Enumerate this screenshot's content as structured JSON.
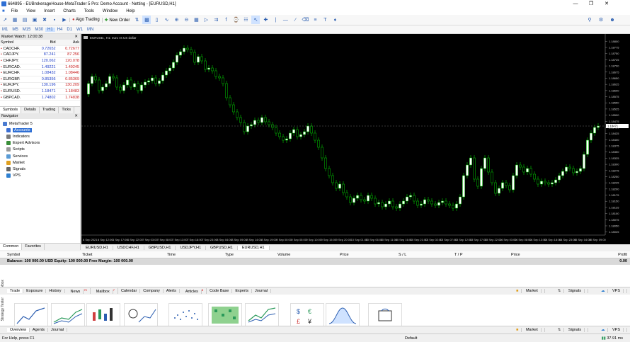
{
  "window": {
    "title": "664895 - EUBrokerageHouse-MetaTrader 5 Pro: Demo Account - Netting - [EURUSD,H1]"
  },
  "menu": [
    "File",
    "View",
    "Insert",
    "Charts",
    "Tools",
    "Window",
    "Help"
  ],
  "toolbar": {
    "algo_trading": "Algo Trading",
    "new_order": "New Order"
  },
  "timeframes": [
    "M1",
    "M5",
    "M15",
    "M30",
    "H1",
    "H4",
    "D1",
    "W1",
    "MN"
  ],
  "market_watch": {
    "title": "Market Watch: 12:00:38",
    "headers": [
      "Symbol",
      "Bid",
      "Ask"
    ],
    "rows": [
      {
        "symbol": "CADCHF.",
        "bid": "0.72652",
        "ask": "0.72677"
      },
      {
        "symbol": "CADJPY.",
        "bid": "87.241",
        "ask": "87.256"
      },
      {
        "symbol": "CHFJPY.",
        "bid": "120.062",
        "ask": "120.078"
      },
      {
        "symbol": "EURCAD.",
        "bid": "1.49221",
        "ask": "1.49245"
      },
      {
        "symbol": "EURCHF.",
        "bid": "1.08432",
        "ask": "1.08446"
      },
      {
        "symbol": "EURGBP.",
        "bid": "0.85356",
        "ask": "0.85369"
      },
      {
        "symbol": "EURJPY.",
        "bid": "130.196",
        "ask": "130.209"
      },
      {
        "symbol": "EURUSD.",
        "bid": "1.18471",
        "ask": "1.18483"
      },
      {
        "symbol": "GBPCAD.",
        "bid": "1.74802",
        "ask": "1.74838"
      }
    ],
    "tabs": [
      "Symbols",
      "Details",
      "Trading",
      "Ticks"
    ]
  },
  "navigator": {
    "title": "Navigator",
    "items": [
      {
        "label": "MetaTrader 5",
        "color": "#4a7bd1"
      },
      {
        "label": "Accounts",
        "color": "#3b6fd4"
      },
      {
        "label": "Indicators",
        "color": "#7a7a7a"
      },
      {
        "label": "Expert Advisors",
        "color": "#3a8f3a"
      },
      {
        "label": "Scripts",
        "color": "#999999"
      },
      {
        "label": "Services",
        "color": "#5a9bd5"
      },
      {
        "label": "Market",
        "color": "#e0a020"
      },
      {
        "label": "Signals",
        "color": "#666666"
      },
      {
        "label": "VPS",
        "color": "#2f80d0"
      }
    ],
    "tabs": [
      "Common",
      "Favorites"
    ]
  },
  "chart": {
    "title": "EURUSD., H1: euro vs US dollar",
    "price_labels": [
      "1.18800",
      "1.18775",
      "1.18750",
      "1.18725",
      "1.18700",
      "1.18675",
      "1.18650",
      "1.18625",
      "1.18600",
      "1.18575",
      "1.18550",
      "1.18525",
      "1.18500",
      "1.18475",
      "1.18450",
      "1.18425",
      "1.18400",
      "1.18375",
      "1.18350",
      "1.18325",
      "1.18300",
      "1.18275",
      "1.18250",
      "1.18225",
      "1.18200",
      "1.18175",
      "1.18150",
      "1.18125",
      "1.18100",
      "1.18075",
      "1.18050",
      "1.18025"
    ],
    "current_price": "1.18471",
    "time_labels": [
      "6 Sep 2021",
      "6 Sep 12:00",
      "6 Sep 17:00",
      "6 Sep 22:00",
      "7 Sep 03:00",
      "7 Sep 08:00",
      "7 Sep 13:00",
      "7 Sep 18:00",
      "7 Sep 23:00",
      "8 Sep 04:00",
      "8 Sep 09:00",
      "8 Sep 14:00",
      "8 Sep 19:00",
      "9 Sep 00:00",
      "9 Sep 05:00",
      "9 Sep 10:00",
      "9 Sep 15:00",
      "9 Sep 20:00",
      "10 Sep 01:00",
      "10 Sep 06:00",
      "10 Sep 11:00",
      "10 Sep 16:00",
      "10 Sep 21:00",
      "13 Sep 02:00",
      "13 Sep 07:00",
      "13 Sep 12:00",
      "13 Sep 17:00",
      "13 Sep 22:00",
      "14 Sep 03:00",
      "14 Sep 08:00",
      "14 Sep 13:00",
      "14 Sep 18:00",
      "14 Sep 23:00",
      "15 Sep 04:00",
      "15 Sep 09:00"
    ],
    "bull_color": "#ffffff",
    "bear_color": "#000000",
    "wick_color": "#00c800"
  },
  "chart_tabs": [
    "EURUSD,H1",
    "USDCHF,H1",
    "GBPUSD,H1",
    "USDJPY,H1",
    "GBPUSD,H1",
    "EURUSD,H1"
  ],
  "trade": {
    "headers": [
      "Symbol",
      "Ticket",
      "Time",
      "Type",
      "Volume",
      "Price",
      "S / L",
      "T / P",
      "Price",
      "Profit"
    ],
    "balance": "Balance: 100 000.00 USD  Equity: 100 000.00  Free Margin: 100 000.00",
    "balance_profit": "0.00"
  },
  "toolbox_tabs": [
    "Trade",
    "Exposure",
    "History",
    "News",
    "Mailbox",
    "Calendar",
    "Company",
    "Alerts",
    "Articles",
    "Code Base",
    "Experts",
    "Journal"
  ],
  "toolbox_badges": {
    "news": "79",
    "mailbox": "7",
    "articles": "8"
  },
  "right_links": [
    "Market",
    "Signals",
    "VPS"
  ],
  "market_tabs": [
    "Overview",
    "Agents",
    "Journal"
  ],
  "side_labels": {
    "toolbox": "Toolbox",
    "strategy": "Strategy Tester"
  },
  "status": {
    "help": "For Help, press F1",
    "profile": "Default",
    "ping": "37.91 ms"
  }
}
